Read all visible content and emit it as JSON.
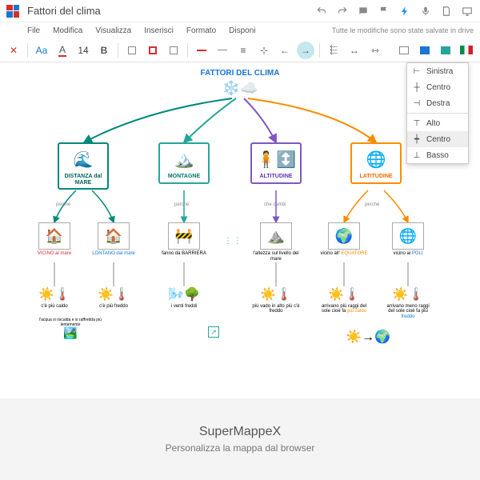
{
  "header": {
    "doc_title": "Fattori del clima"
  },
  "menu": {
    "items": [
      "File",
      "Modifica",
      "Visualizza",
      "Inserisci",
      "Formato",
      "Disponi"
    ],
    "save_status": "Tutte le modifiche sono state salvate in drive"
  },
  "toolbar": {
    "font_family": "Aa",
    "font_size": "14",
    "bold": "B"
  },
  "dropdown": {
    "items": [
      "Sinistra",
      "Centro",
      "Destra",
      "Alto",
      "Centro",
      "Basso"
    ],
    "selected_index": 4
  },
  "map": {
    "root": "FATTORI DEL CLIMA",
    "branches": [
      {
        "label": "DISTANZA dal MARE",
        "color": "#00897b"
      },
      {
        "label": "MONTAGNE",
        "color": "#26a69a"
      },
      {
        "label": "ALTITUDINE",
        "color": "#7e57c2"
      },
      {
        "label": "LATITUDINE",
        "color": "#fb8c00"
      }
    ],
    "sub": {
      "vicino": "VICINO al mare",
      "lontano": "LONTANO dal mare",
      "barriera": "fanno da BARRIERA",
      "altezza": "l'altezza sul livello del mare",
      "equatore": "vicino all' EQUATORE",
      "poli": "vicino ai POLI"
    },
    "leaves": {
      "caldo": "c'è più caldo",
      "freddo": "c'è più freddo",
      "tempo": "l'acqua si riscalda e si raffredda più lentamente",
      "venti": "i venti freddi",
      "vado": "più vado in alto più c'è freddo",
      "raggi_piu": "arrivano più raggi del sole cioè fa più caldo",
      "raggi_meno": "arrivano meno raggi del sole cioè fa più freddo"
    },
    "edge": {
      "perche": "perché",
      "che_cambi": "che cambi"
    }
  },
  "footer": {
    "title": "SuperMappeX",
    "subtitle": "Personalizza la mappa dal browser"
  }
}
